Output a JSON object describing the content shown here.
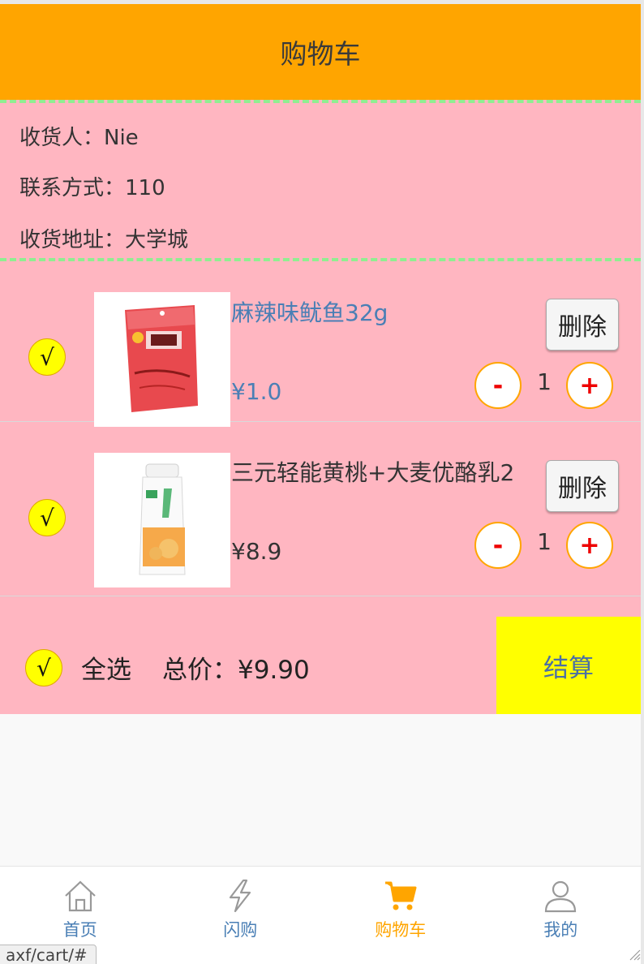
{
  "header": {
    "title": "购物车"
  },
  "address": {
    "receiver": "收货人：Nie",
    "contact": "联系方式：110",
    "location": "收货地址：大学城"
  },
  "check_mark": "√",
  "items": [
    {
      "name": "麻辣味鱿鱼32g",
      "price": "¥1.0",
      "quantity": "1",
      "delete_label": "删除",
      "minus_label": "-",
      "plus_label": "+",
      "name_color": "#4a7fb5",
      "price_color": "#4a7fb5"
    },
    {
      "name": "三元轻能黄桃+大麦优酪乳2",
      "price": "¥8.9",
      "quantity": "1",
      "delete_label": "删除",
      "minus_label": "-",
      "plus_label": "+",
      "name_color": "#333333",
      "price_color": "#333333"
    }
  ],
  "summary": {
    "select_all_label": "全选",
    "total_text": "总价：¥9.90",
    "checkout_label": "结算"
  },
  "tabbar": {
    "tabs": [
      {
        "label": "首页",
        "icon": "home-icon",
        "active": false
      },
      {
        "label": "闪购",
        "icon": "lightning-icon",
        "active": false
      },
      {
        "label": "购物车",
        "icon": "cart-icon",
        "active": true
      },
      {
        "label": "我的",
        "icon": "user-icon",
        "active": false
      }
    ]
  },
  "status_url": "axf/cart/#",
  "colors": {
    "header_bg": "#ffa500",
    "content_bg": "#ffb6c1",
    "divider": "#90ee90",
    "check_bg": "#ffff00",
    "checkout_bg": "#ffff00",
    "active_tab": "#ffa500",
    "inactive_tab": "#4a7fb5"
  }
}
